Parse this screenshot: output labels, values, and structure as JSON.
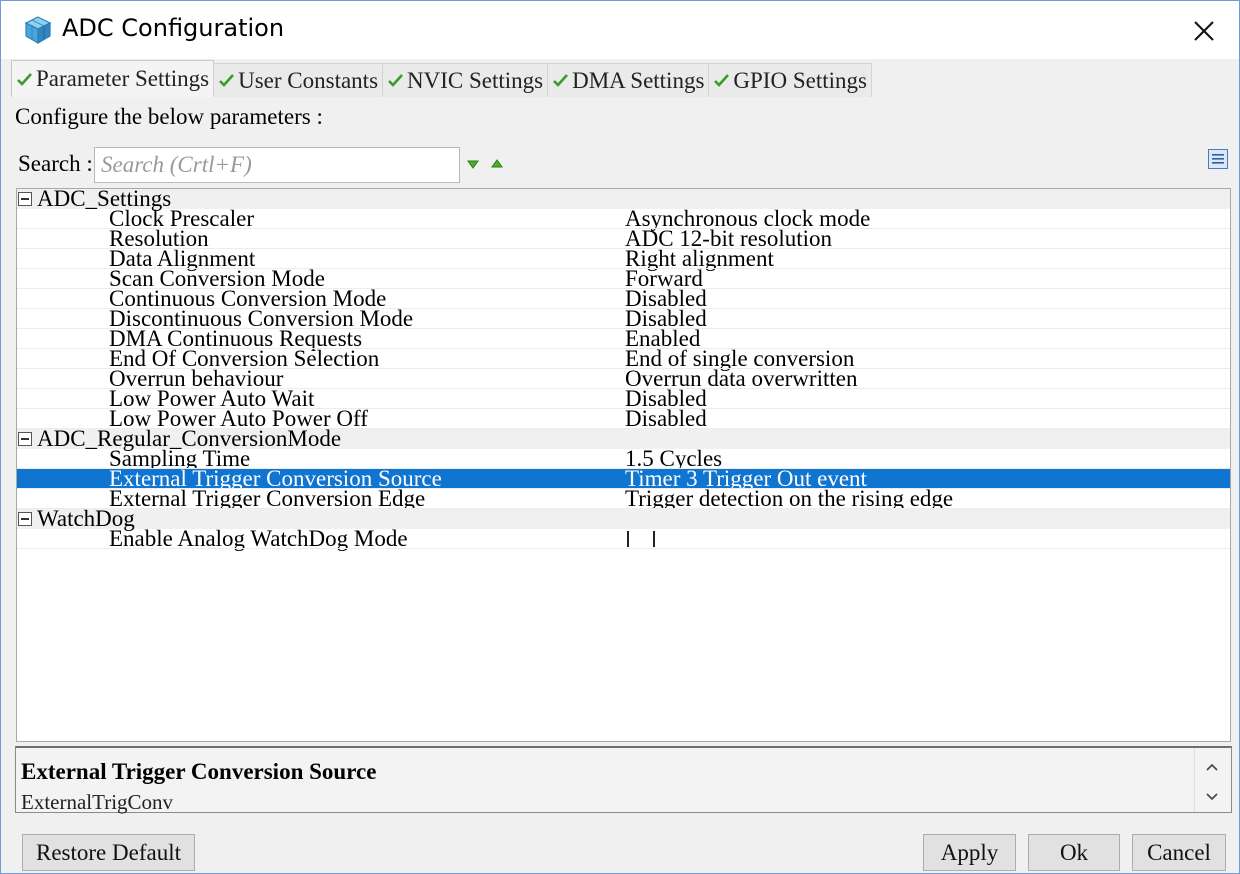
{
  "window": {
    "title": "ADC Configuration"
  },
  "tabs": [
    {
      "label": "Parameter Settings",
      "active": true
    },
    {
      "label": "User Constants"
    },
    {
      "label": "NVIC Settings"
    },
    {
      "label": "DMA Settings"
    },
    {
      "label": "GPIO Settings"
    }
  ],
  "configure_label": "Configure the below parameters :",
  "search": {
    "label": "Search :",
    "placeholder": "Search (Crtl+F)"
  },
  "groups": [
    {
      "name": "ADC_Settings",
      "params": [
        {
          "name": "Clock Prescaler",
          "value": "Asynchronous clock mode"
        },
        {
          "name": "Resolution",
          "value": "ADC 12-bit resolution"
        },
        {
          "name": "Data Alignment",
          "value": "Right alignment"
        },
        {
          "name": "Scan Conversion Mode",
          "value": "Forward"
        },
        {
          "name": "Continuous Conversion Mode",
          "value": "Disabled"
        },
        {
          "name": "Discontinuous Conversion Mode",
          "value": "Disabled"
        },
        {
          "name": "DMA Continuous Requests",
          "value": "Enabled"
        },
        {
          "name": "End Of Conversion Selection",
          "value": "End of single conversion"
        },
        {
          "name": "Overrun behaviour",
          "value": "Overrun data overwritten"
        },
        {
          "name": "Low Power Auto Wait",
          "value": "Disabled"
        },
        {
          "name": "Low Power Auto Power Off",
          "value": "Disabled"
        }
      ]
    },
    {
      "name": "ADC_Regular_ConversionMode",
      "params": [
        {
          "name": "Sampling Time",
          "value": "1.5 Cycles"
        },
        {
          "name": "External Trigger Conversion Source",
          "value": "Timer 3 Trigger Out event",
          "selected": true
        },
        {
          "name": "External Trigger Conversion Edge",
          "value": "Trigger detection on the rising edge"
        }
      ]
    },
    {
      "name": "WatchDog",
      "params": [
        {
          "name": "Enable Analog WatchDog Mode",
          "checkbox": true,
          "checked": false
        }
      ]
    }
  ],
  "description": {
    "title": "External Trigger Conversion Source",
    "subtitle": "ExternalTrigConv"
  },
  "buttons": {
    "restore": "Restore Default",
    "apply": "Apply",
    "ok": "Ok",
    "cancel": "Cancel"
  },
  "colors": {
    "selection": "#1075d1",
    "check_green": "#3a9a2a",
    "window_border": "#6d9ad8"
  }
}
